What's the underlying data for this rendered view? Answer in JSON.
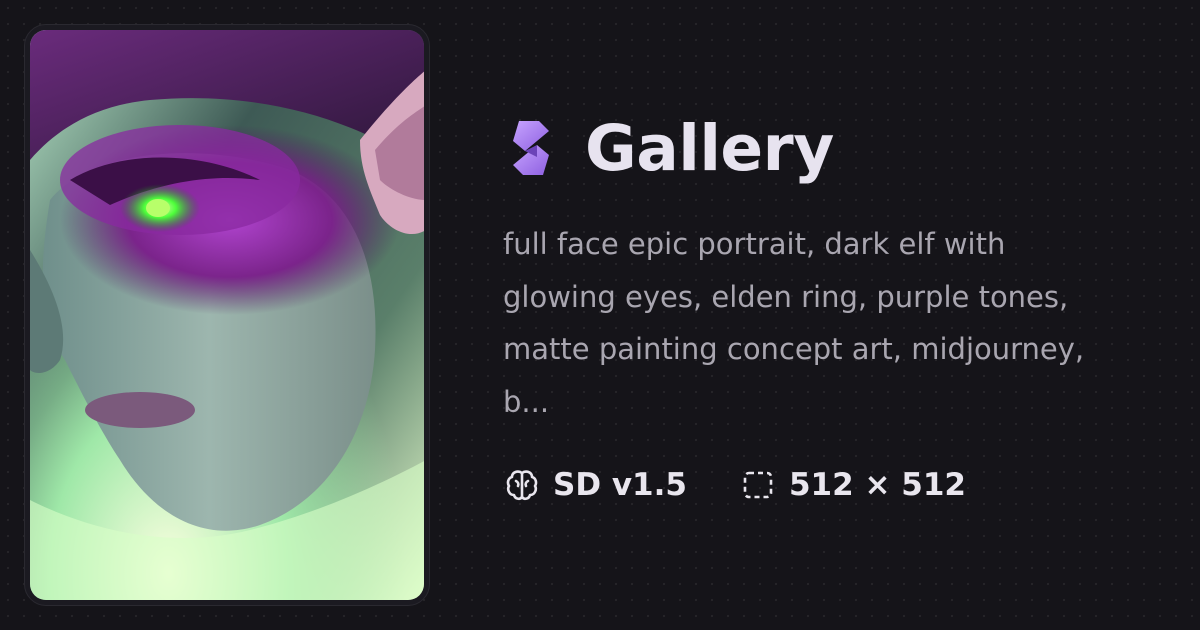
{
  "card": {
    "image_alt": "Dark elf portrait with glowing green eyes and purple tones"
  },
  "header": {
    "logo_icon": "gallery-logo-icon",
    "title": "Gallery"
  },
  "prompt": {
    "text": "full face epic portrait, dark elf with glowing eyes, elden ring, purple tones, matte painting concept art, midjourney, b..."
  },
  "meta": {
    "model": {
      "icon": "brain-icon",
      "label": "SD v1.5"
    },
    "size": {
      "icon": "dimensions-icon",
      "label": "512 × 512"
    }
  },
  "colors": {
    "background": "#151419",
    "accent": "#b08cf0",
    "title": "#e7e3ef",
    "prompt": "#a9a6b0"
  }
}
